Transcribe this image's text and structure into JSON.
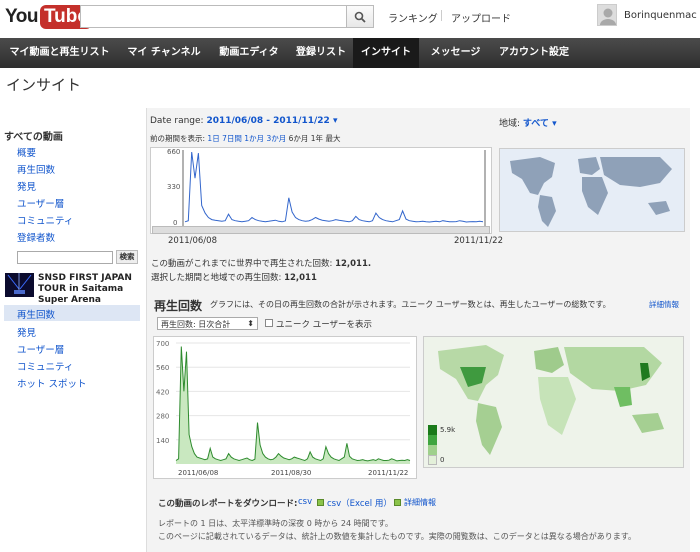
{
  "header": {
    "logo_you": "You",
    "logo_tube": "Tube",
    "search_placeholder": "",
    "link_ranking": "ランキング",
    "link_upload": "アップロード",
    "username": "Borinquenmac"
  },
  "nav": {
    "items": [
      "マイ動画と再生リスト",
      "マイ チャンネル",
      "動画エディタ",
      "登録リスト",
      "インサイト",
      "メッセージ",
      "アカウント設定"
    ],
    "active_index": 4
  },
  "page_title": "インサイト",
  "sidebar": {
    "all_videos_heading": "すべての動画",
    "all_links": [
      "概要",
      "再生回数",
      "発見",
      "ユーザー層",
      "コミュニティ",
      "登録者数"
    ],
    "search_button": "検索",
    "video_title": "SNSD FIRST JAPAN TOUR in Saitama Super Arena",
    "video_links": [
      "再生回数",
      "発見",
      "ユーザー層",
      "コミュニティ",
      "ホット スポット"
    ],
    "active_video_link": "再生回数"
  },
  "filters": {
    "date_range_label": "Date range:",
    "date_range_value": "2011/06/08 - 2011/11/22",
    "region_label": "地域:",
    "region_value": "すべて",
    "period_label": "前の期間を表示:",
    "periods": [
      "1日",
      "7日間",
      "1か月",
      "3か月",
      "6か月",
      "1年",
      "最大"
    ]
  },
  "overview_chart": {
    "y_ticks": [
      "660",
      "330",
      "0"
    ],
    "x_start": "2011/06/08",
    "x_end": "2011/11/22"
  },
  "stats": {
    "worldwide_label": "この動画がこれまでに世界中で再生された回数:",
    "worldwide_value": "12,011.",
    "period_label": "選択した期間と地域での再生回数:",
    "period_value": "12,011"
  },
  "views_section": {
    "title": "再生回数",
    "description": "グラフには、その日の再生回数の合計が示されます。ユニーク ユーザー数とは、再生したユーザーの総数です。",
    "details_link": "詳細情報",
    "select_value": "再生回数: 日次合計",
    "checkbox_label": "ユニーク ユーザーを表示"
  },
  "chart_data": {
    "type": "area",
    "title": "",
    "xlabel": "",
    "ylabel": "",
    "ylim": [
      0,
      700
    ],
    "y_ticks": [
      140,
      280,
      420,
      560,
      700
    ],
    "x_tick_labels": [
      "2011/06/08",
      "2011/08/30",
      "2011/11/22"
    ],
    "series": [
      {
        "values": [
          20,
          30,
          680,
          420,
          650,
          170,
          100,
          60,
          40,
          35,
          30,
          25,
          30,
          90,
          40,
          30,
          25,
          20,
          25,
          30,
          60,
          40,
          30,
          25,
          20,
          25,
          30,
          35,
          25,
          20,
          28,
          240,
          110,
          60,
          40,
          30,
          25,
          28,
          40,
          60,
          45,
          35,
          30,
          25,
          30,
          40,
          35,
          30,
          25,
          20,
          30,
          70,
          40,
          30,
          25,
          20,
          30,
          100,
          60,
          40,
          30,
          25,
          20,
          30,
          40,
          120,
          45,
          30,
          25,
          20,
          22,
          25,
          20,
          18,
          22,
          25,
          20,
          30,
          25,
          20,
          20,
          22,
          30,
          25,
          18,
          20,
          22,
          20,
          25,
          20
        ]
      }
    ],
    "color": "#2e8b2e",
    "fill": "#c9e8c0"
  },
  "map_legend": {
    "max_label": "5.9k",
    "min_label": "0",
    "colors": [
      "#1a7a1a",
      "#3fa53f",
      "#7cc56e",
      "#b6dca8",
      "#e8f3e0"
    ]
  },
  "download": {
    "label": "この動画のレポートをダウンロード:",
    "csv": "csv",
    "csv_excel": "csv（Excel 用）",
    "details": "詳細情報"
  },
  "footnotes": [
    "レポートの 1 日は、太平洋標準時の深夜 0 時から 24 時間です。",
    "このページに記載されているデータは、統計上の数値を集計したものです。実際の閲覧数は、このデータとは異なる場合があります。"
  ],
  "colors": {
    "link": "#1155cc",
    "nav_bg": "#3a3a3a",
    "brand_red": "#c4302b"
  }
}
